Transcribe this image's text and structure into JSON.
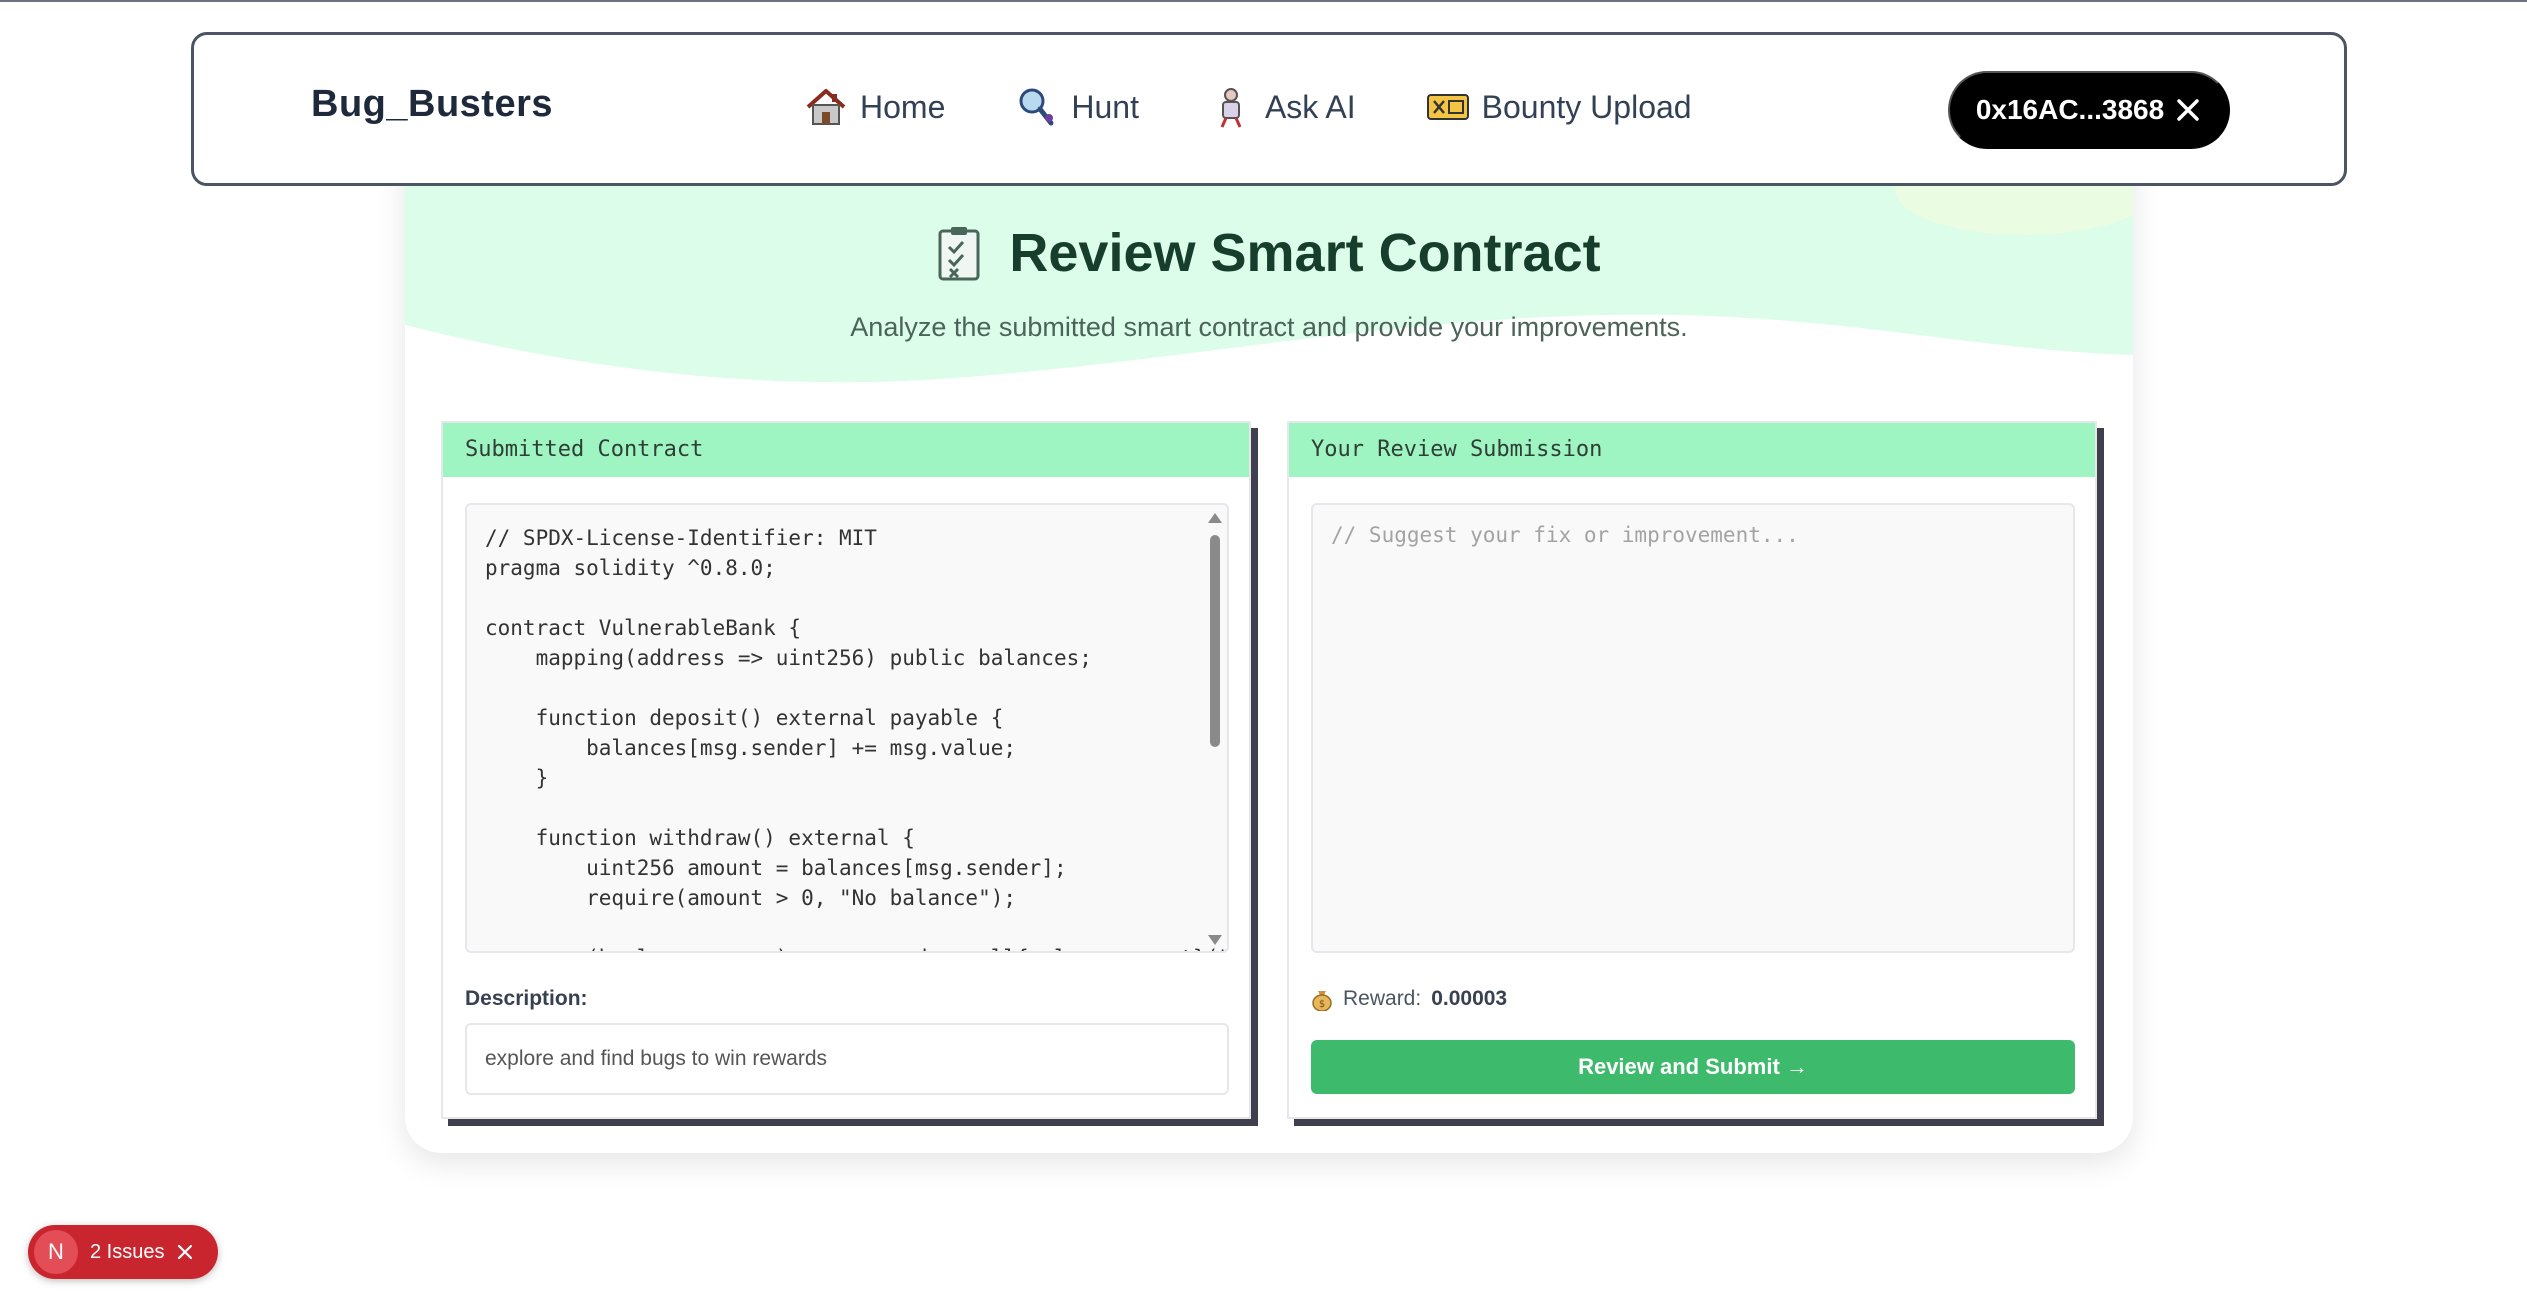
{
  "navbar": {
    "brand": "Bug_Busters",
    "links": [
      {
        "label": "Home",
        "icon": "house-icon"
      },
      {
        "label": "Hunt",
        "icon": "magnifier-icon"
      },
      {
        "label": "Ask AI",
        "icon": "robot-icon"
      },
      {
        "label": "Bounty Upload",
        "icon": "ticket-icon"
      }
    ],
    "wallet_label": "0x16AC...3868"
  },
  "hero": {
    "title": "Review Smart Contract",
    "subtitle": "Analyze the submitted smart contract and provide your improvements."
  },
  "left_panel": {
    "header": "Submitted Contract",
    "code": "// SPDX-License-Identifier: MIT\npragma solidity ^0.8.0;\n\ncontract VulnerableBank {\n    mapping(address => uint256) public balances;\n\n    function deposit() external payable {\n        balances[msg.sender] += msg.value;\n    }\n\n    function withdraw() external {\n        uint256 amount = balances[msg.sender];\n        require(amount > 0, \"No balance\");\n\n        (bool success, ) = msg.sender.call{value: amount}(\"\");",
    "description_label": "Description:",
    "description_value": "explore and find bugs to win rewards"
  },
  "right_panel": {
    "header": "Your Review Submission",
    "placeholder": "// Suggest your fix or improvement...",
    "reward_label": "Reward:",
    "reward_value": "0.00003",
    "submit_label": "Review and Submit →"
  },
  "issues_badge": {
    "letter": "N",
    "label": "2 Issues"
  },
  "colors": {
    "panel_header": "#9ef5c2",
    "submit_button": "#3dba6c",
    "hero_wave": "#dcfde9",
    "issues_badge": "#c9252f"
  }
}
